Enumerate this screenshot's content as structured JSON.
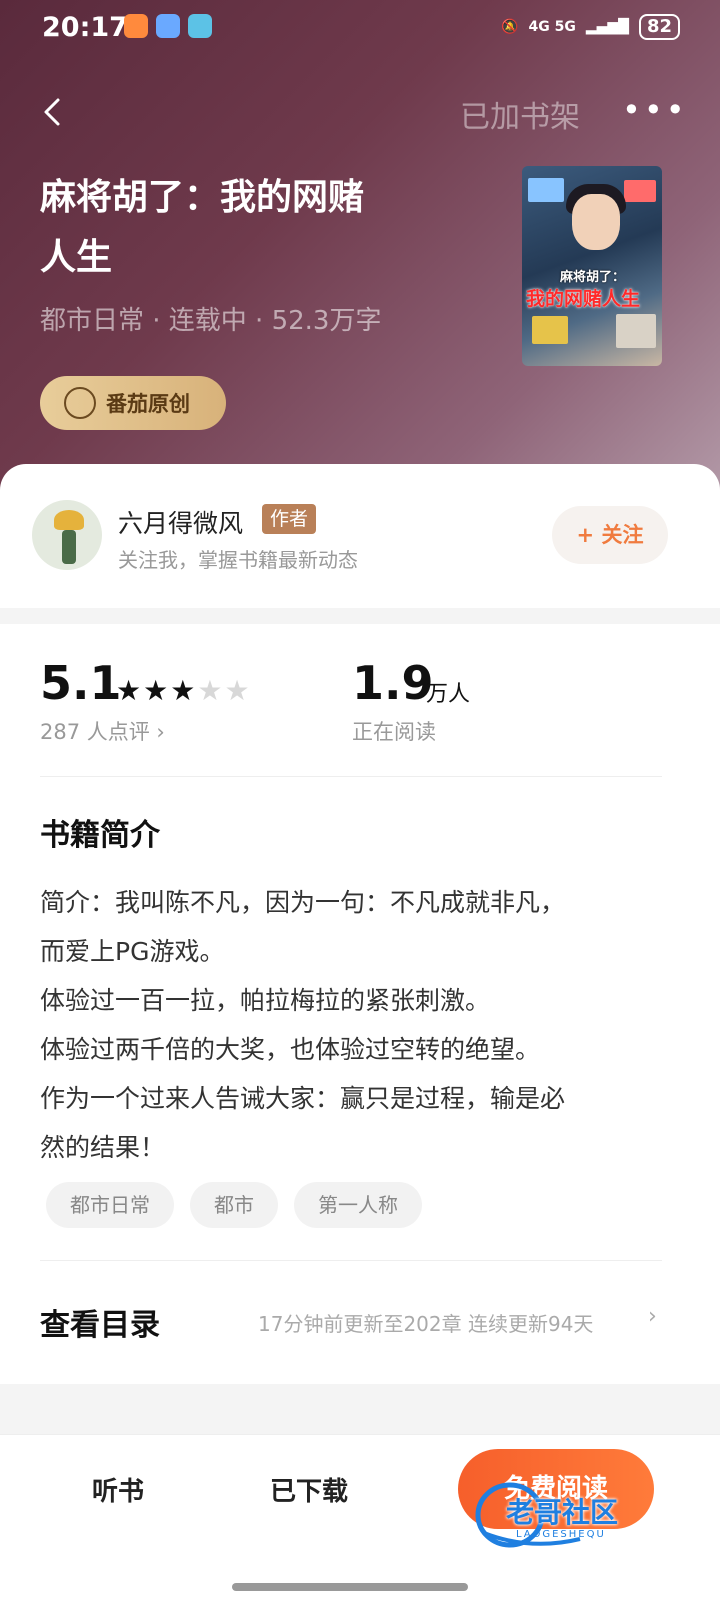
{
  "status_bar": {
    "time": "20:17",
    "network": "4G  5G",
    "battery": "82"
  },
  "header": {
    "shelf_label": "已加书架",
    "more_icon": "more-dots-icon"
  },
  "book": {
    "title_line1": "麻将胡了：我的网赌",
    "title_line2": "人生",
    "meta": "都市日常 · 连载中 · 52.3万字",
    "badge": "番茄原创",
    "cover_title_small": "麻将胡了：",
    "cover_title_large": "我的网赌人生"
  },
  "author": {
    "name": "六月得微风",
    "role_tag": "作者",
    "desc": "关注我，掌握书籍最新动态",
    "follow_label": "+ 关注"
  },
  "stats": {
    "score": "5.1",
    "rating_stars": 3,
    "rating_max": 5,
    "reviews": "287 人点评 ›",
    "readers_num": "1.9",
    "readers_unit": "万人",
    "readers_label": "正在阅读"
  },
  "synopsis": {
    "title": "书籍简介",
    "lines": [
      "简介：我叫陈不凡，因为一句：不凡成就非凡，",
      "而爱上PG游戏。",
      "体验过一百一拉，帕拉梅拉的紧张刺激。",
      "体验过两千倍的大奖，也体验过空转的绝望。",
      "作为一个过来人告诫大家：赢只是过程，输是必",
      "然的结果！"
    ],
    "tags": [
      "都市日常",
      "都市",
      "第一人称"
    ]
  },
  "toc": {
    "title": "查看目录",
    "info": "17分钟前更新至202章 连续更新94天"
  },
  "bottom_bar": {
    "listen": "听书",
    "downloaded": "已下载",
    "read": "免费阅读",
    "watermark": "老哥社区",
    "watermark_sub": "LAOGESHEQU"
  },
  "colors": {
    "accent": "#f65f2b",
    "hero": "#6f3a4c",
    "badge": "#e8cd9a"
  }
}
